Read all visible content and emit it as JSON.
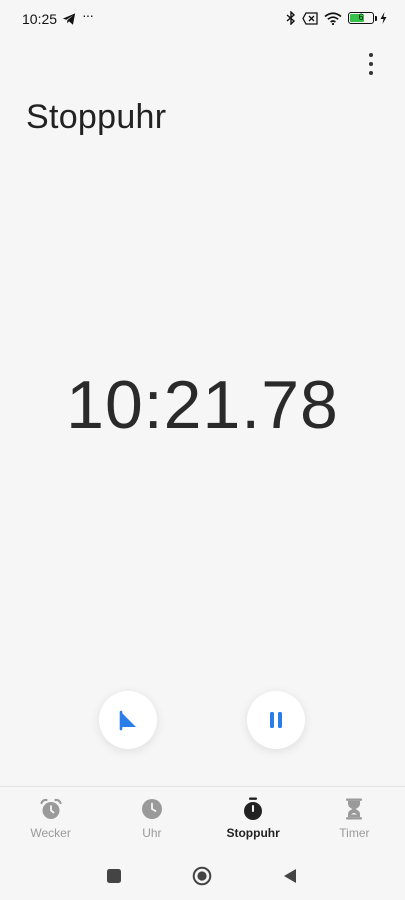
{
  "status_bar": {
    "time": "10:25",
    "more": "···",
    "battery": "6"
  },
  "header": {
    "title": "Stoppuhr"
  },
  "stopwatch": {
    "elapsed": "10:21.78"
  },
  "nav": {
    "items": [
      {
        "label": "Wecker",
        "icon": "alarm-clock-icon"
      },
      {
        "label": "Uhr",
        "icon": "clock-icon"
      },
      {
        "label": "Stoppuhr",
        "icon": "stopwatch-icon"
      },
      {
        "label": "Timer",
        "icon": "hourglass-icon"
      }
    ],
    "active": "Stoppuhr"
  },
  "colors": {
    "accent": "#2b7de9",
    "inactive": "#9a9a9a",
    "active": "#222222",
    "background": "#f6f6f6"
  }
}
